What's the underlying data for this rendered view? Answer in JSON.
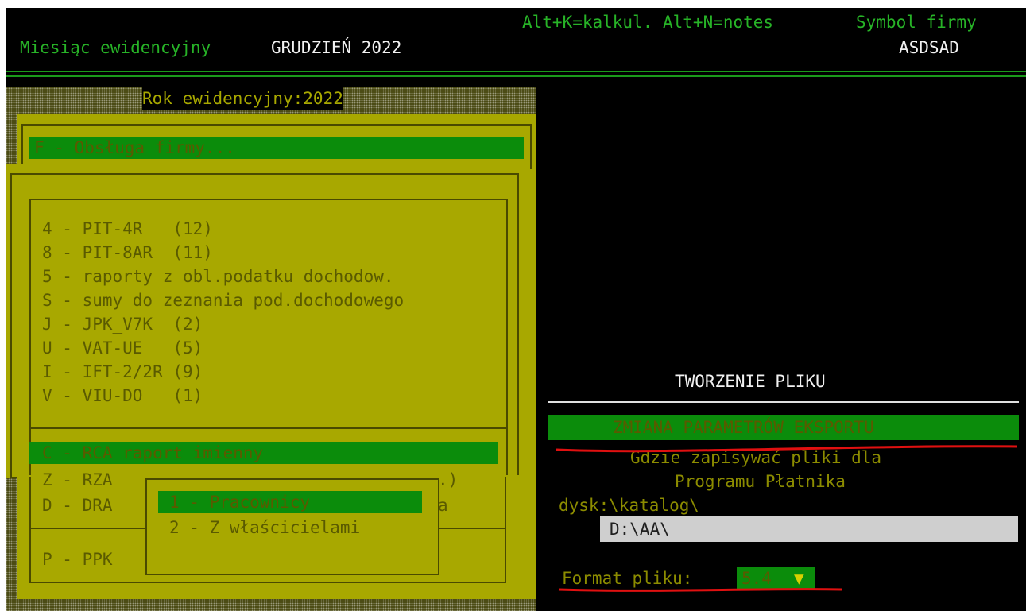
{
  "header": {
    "month_label": "Miesiąc ewidencyjny",
    "month_value": "GRUDZIEŃ 2022",
    "shortcuts": "Alt+K=kalkul. Alt+N=notes",
    "company_label": "Symbol firmy",
    "company_value": "ASDSAD"
  },
  "panel": {
    "year_title": "Rok ewidencyjny:2022",
    "company_menu": "F - Obsługa firmy...",
    "items": [
      "4 - PIT-4R   (12)",
      "8 - PIT-8AR  (11)",
      "5 - raporty z obl.podatku dochodow.",
      "S - sumy do zeznania pod.dochodowego",
      "J - JPK_V7K  (2)",
      "U - VAT-UE   (5)",
      "I - IFT-2/2R (9)",
      "V - VIU-DO   (1)"
    ],
    "zus_items": [
      "C - RCA raport imienny",
      "Z - RZA",
      "D - DRA",
      "P - PPK"
    ],
    "partial_z": ".)",
    "partial_d": "a"
  },
  "popup": {
    "options": [
      "1 - Pracownicy",
      "2 - Z właścicielami"
    ]
  },
  "right": {
    "title": "TWORZENIE PLIKU",
    "selected": "ZMIANA PARAMETRÓW EKSPORTU",
    "line1": "Gdzie zapisywać pliki dla",
    "line2": "Programu Płatnika",
    "path_label": "dysk:\\katalog\\",
    "path_value": "D:\\AA\\",
    "format_label": "Format pliku:",
    "format_value": "5.4",
    "dropdown_glyph": "▼"
  },
  "colors": {
    "accent_green": "#0b8c0b",
    "panel_yellow": "#a8a800",
    "annotation_red": "#e01010"
  }
}
